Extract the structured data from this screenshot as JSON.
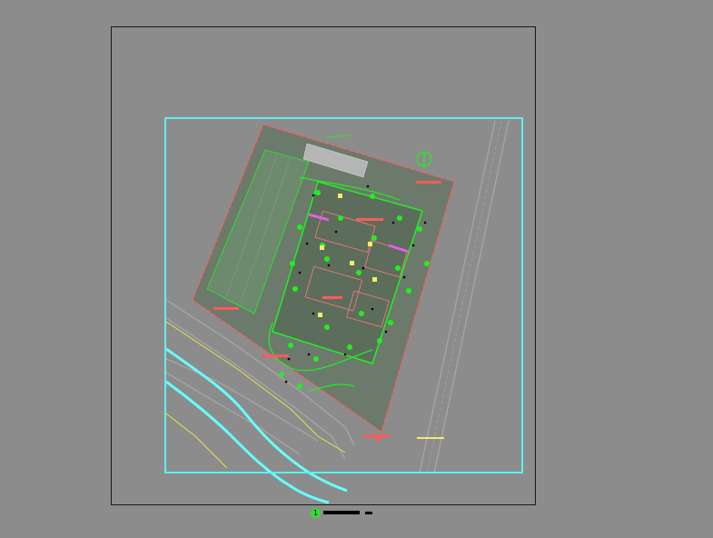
{
  "colors": {
    "background": "#8c8c8c",
    "sheet_border": "#1a1a1a",
    "viewport_border": "#5ff0f0",
    "site_boundary": "#ff5a5a",
    "landscape": "#22ee22",
    "river": "#66ffff",
    "road": "#a8a8a8",
    "annotation_yellow": "#f0f060"
  },
  "viewport_label": {
    "number": "1"
  },
  "icons": {
    "north_arrow": "north-arrow-icon"
  }
}
